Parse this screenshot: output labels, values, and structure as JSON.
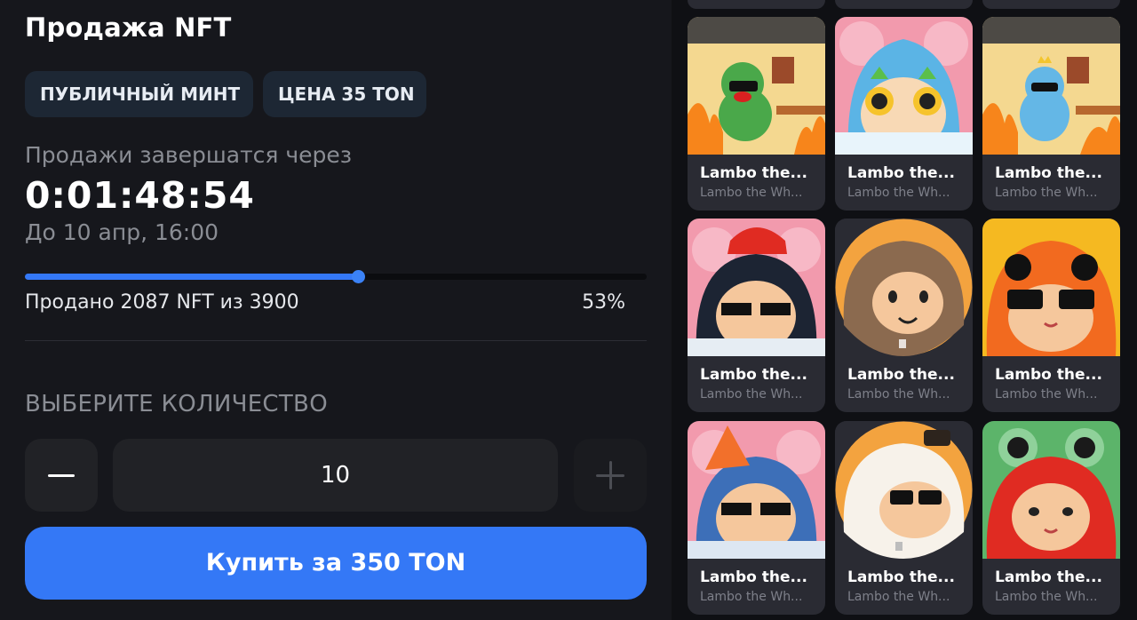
{
  "sale": {
    "title": "Продажа NFT",
    "badge_mint": "ПУБЛИЧНЫЙ МИНТ",
    "badge_price": "ЦЕНА 35 TON",
    "ends_label": "Продажи завершатся через",
    "countdown": "0:01:48:54",
    "until": "До 10 апр, 16:00",
    "progress_fraction": 0.535,
    "sold_text": "Продано 2087 NFT из 3900",
    "percent_text": "53%"
  },
  "quantity": {
    "label": "ВЫБЕРИТЕ КОЛИЧЕСТВО",
    "value": "10"
  },
  "buy_label": "Купить за 350 TON",
  "colors": {
    "accent": "#3478f6",
    "panel": "#16171c",
    "card": "#2a2b33"
  },
  "cards": [
    {
      "name": "Lambo the...",
      "sub": "Lambo the Wh...",
      "art": "frog-fire"
    },
    {
      "name": "Lambo the...",
      "sub": "Lambo the Wh...",
      "art": "unicorn-shark"
    },
    {
      "name": "Lambo the...",
      "sub": "Lambo the Wh...",
      "art": "crown-fire"
    },
    {
      "name": "Lambo the...",
      "sub": "Lambo the Wh...",
      "art": "orca-hat"
    },
    {
      "name": "Lambo the...",
      "sub": "Lambo the Wh...",
      "art": "monkey-video"
    },
    {
      "name": "Lambo the...",
      "sub": "Lambo the Wh...",
      "art": "duck-shades"
    },
    {
      "name": "Lambo the...",
      "sub": "Lambo the Wh...",
      "art": "shark-cone"
    },
    {
      "name": "Lambo the...",
      "sub": "Lambo the Wh...",
      "art": "panda-video"
    },
    {
      "name": "Lambo the...",
      "sub": "Lambo the Wh...",
      "art": "frog-red"
    }
  ]
}
